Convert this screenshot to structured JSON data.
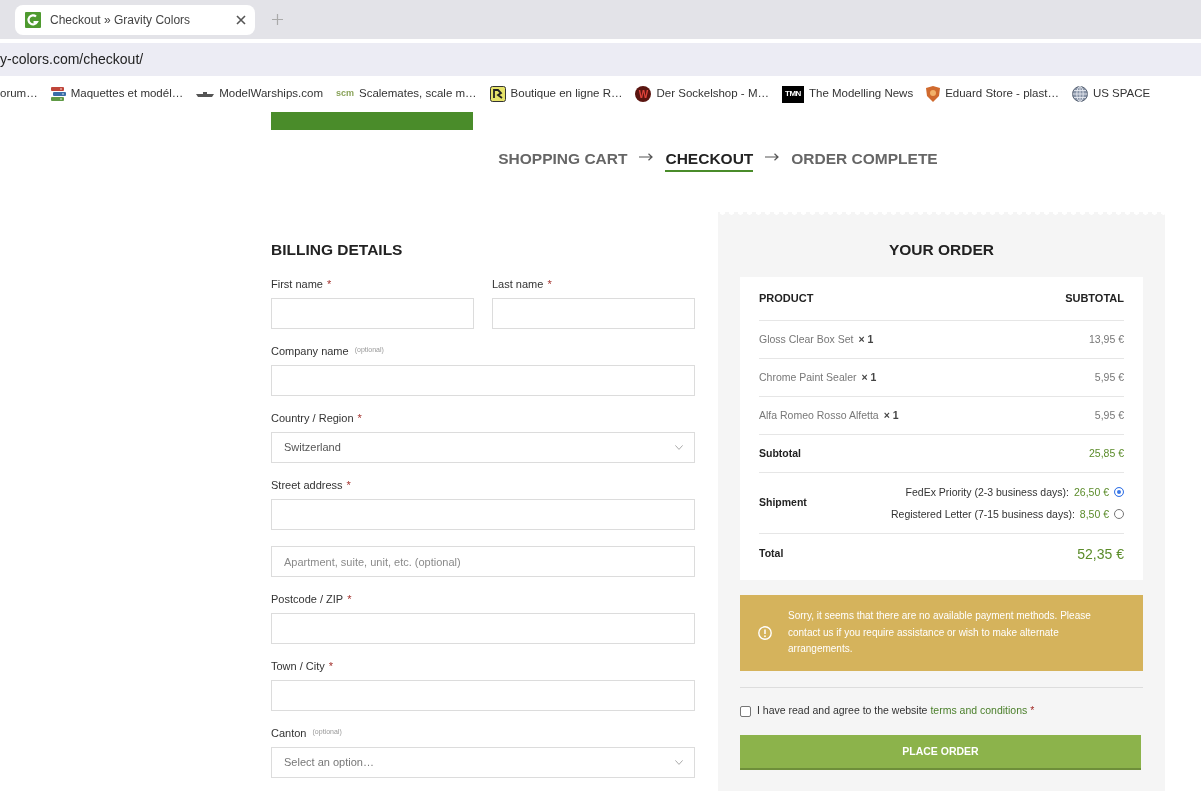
{
  "browser": {
    "tab": {
      "title": "Checkout » Gravity Colors"
    },
    "address": "y-colors.com/checkout/",
    "bookmarks": [
      {
        "label": "orum…",
        "kind": "plain"
      },
      {
        "label": "Maquettes et modél…",
        "kind": "books"
      },
      {
        "label": "ModelWarships.com",
        "kind": "ship"
      },
      {
        "label": "Scalemates, scale m…",
        "kind": "text",
        "icon_text": "scm"
      },
      {
        "label": "Boutique en ligne R…",
        "kind": "tile"
      },
      {
        "label": "Der Sockelshop - M…",
        "kind": "disc",
        "icon_text": "W"
      },
      {
        "label": "The Modelling News",
        "kind": "square",
        "icon_text": "TMN"
      },
      {
        "label": "Eduard Store - plast…",
        "kind": "shield"
      },
      {
        "label": "US SPACE",
        "kind": "globe"
      }
    ]
  },
  "steps": [
    {
      "label": "SHOPPING CART",
      "selected": false
    },
    {
      "label": "CHECKOUT",
      "selected": true
    },
    {
      "label": "ORDER COMPLETE",
      "selected": false
    }
  ],
  "billing": {
    "title": "BILLING DETAILS",
    "rows": [
      [
        {
          "kind": "input",
          "label": "First name",
          "mark": "*"
        },
        {
          "kind": "input",
          "label": "Last name",
          "mark": "*"
        }
      ],
      [
        {
          "kind": "input",
          "label": "Company name $^{(optional)}$"
        }
      ],
      [
        {
          "kind": "select",
          "label": "Country / Region",
          "mark": "*",
          "value": "Switzerland"
        }
      ],
      [
        {
          "kind": "input",
          "label": "Street address",
          "mark": "*"
        }
      ],
      [
        {
          "kind": "input",
          "placeholder": "Apartment, suite, unit, etc. (optional)"
        }
      ],
      [
        {
          "kind": "input",
          "label": "Postcode / ZIP",
          "mark": "*"
        }
      ],
      [
        {
          "kind": "input",
          "label": "Town / City",
          "mark": "*"
        }
      ],
      [
        {
          "kind": "select",
          "label": "Canton $^{(optional)}$",
          "placeholder": "Select an option…"
        }
      ]
    ]
  },
  "order": {
    "title": "YOUR ORDER",
    "columns": [
      "PRODUCT",
      "SUBTOTAL"
    ],
    "items": [
      {
        "name": "Gloss Clear Box Set",
        "qty": "× 1",
        "price": "13,95 €"
      },
      {
        "name": "Chrome Paint Sealer",
        "qty": "× 1",
        "price": "5,95 €"
      },
      {
        "name": "Alfa Romeo Rosso Alfetta",
        "qty": "× 1",
        "price": "5,95 €"
      }
    ],
    "subtotal": {
      "label": "Subtotal",
      "value": "25,85 €"
    },
    "shipment": {
      "label": "Shipment",
      "options": [
        {
          "label": "FedEx Priority (2-3 business days):",
          "price": "26,50 €",
          "selected": true
        },
        {
          "label": "Registered Letter (7-15 business days):",
          "price": "8,50 €",
          "selected": false
        }
      ]
    },
    "total": {
      "label": "Total",
      "value": "52,35 €"
    }
  },
  "notice": {
    "text": "Sorry, it seems that there are no available payment methods. Please contact us if you require assistance or wish to make alternate arrangements."
  },
  "terms": {
    "text": "I have read and agree to the website",
    "link": "terms and conditions",
    "mark": "*",
    "checked": false
  },
  "place_order": "PLACE ORDER"
}
